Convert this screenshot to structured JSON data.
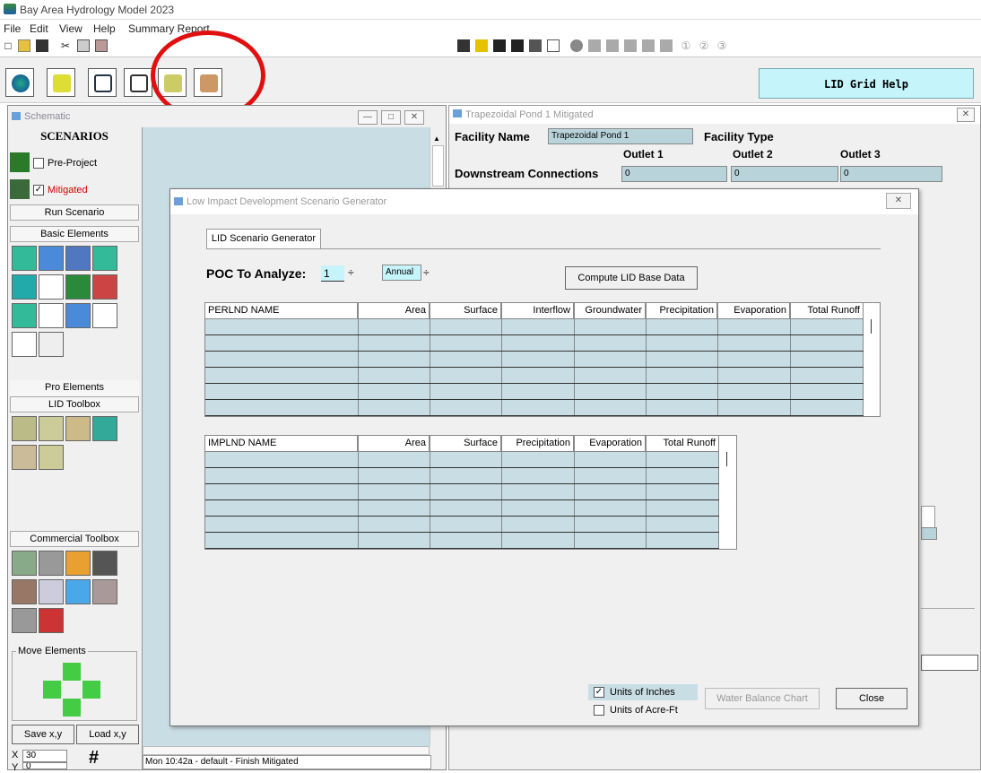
{
  "window": {
    "title": "Bay Area Hydrology Model 2023"
  },
  "menu": [
    "File",
    "Edit",
    "View",
    "Help",
    "Summary Report"
  ],
  "lid_help": "LID Grid Help",
  "schematic": {
    "title": "Schematic",
    "scenarios": "SCENARIOS",
    "pre_project": "Pre-Project",
    "mitigated": "Mitigated",
    "run_scenario": "Run Scenario",
    "basic_elements": "Basic Elements",
    "pro_elements": "Pro Elements",
    "lid_toolbox": "LID Toolbox",
    "commercial_toolbox": "Commercial Toolbox",
    "move_elements": "Move Elements",
    "save_xy": "Save x,y",
    "load_xy": "Load x,y",
    "x_label": "X",
    "x_value": "30",
    "y_label": "Y",
    "y_value": "0",
    "status": "Mon 10:42a - default - Finish Mitigated"
  },
  "facility": {
    "window_title": "Trapezoidal Pond 1 Mitigated",
    "name_label": "Facility Name",
    "name_value": "Trapezoidal Pond 1",
    "type_label": "Facility Type",
    "outlet1": "Outlet 1",
    "outlet2": "Outlet 2",
    "outlet3": "Outlet 3",
    "downstream_label": "Downstream Connections",
    "ds1": "0",
    "ds2": "0",
    "ds3": "0"
  },
  "dialog": {
    "title": "Low Impact Development Scenario Generator",
    "tab": "LID Scenario Generator",
    "poc_label": "POC To Analyze:",
    "poc_value": "1",
    "period": "Annual",
    "compute_button": "Compute LID Base Data",
    "perlnd_headers": [
      "PERLND NAME",
      "Area",
      "Surface",
      "Interflow",
      "Groundwater",
      "Precipitation",
      "Evaporation",
      "Total Runoff"
    ],
    "implnd_headers": [
      "IMPLND NAME",
      "Area",
      "Surface",
      "Precipitation",
      "Evaporation",
      "Total Runoff"
    ],
    "units_inches": "Units of Inches",
    "units_acreft": "Units of Acre-Ft",
    "inches_checked": true,
    "water_balance": "Water Balance Chart",
    "close": "Close"
  }
}
